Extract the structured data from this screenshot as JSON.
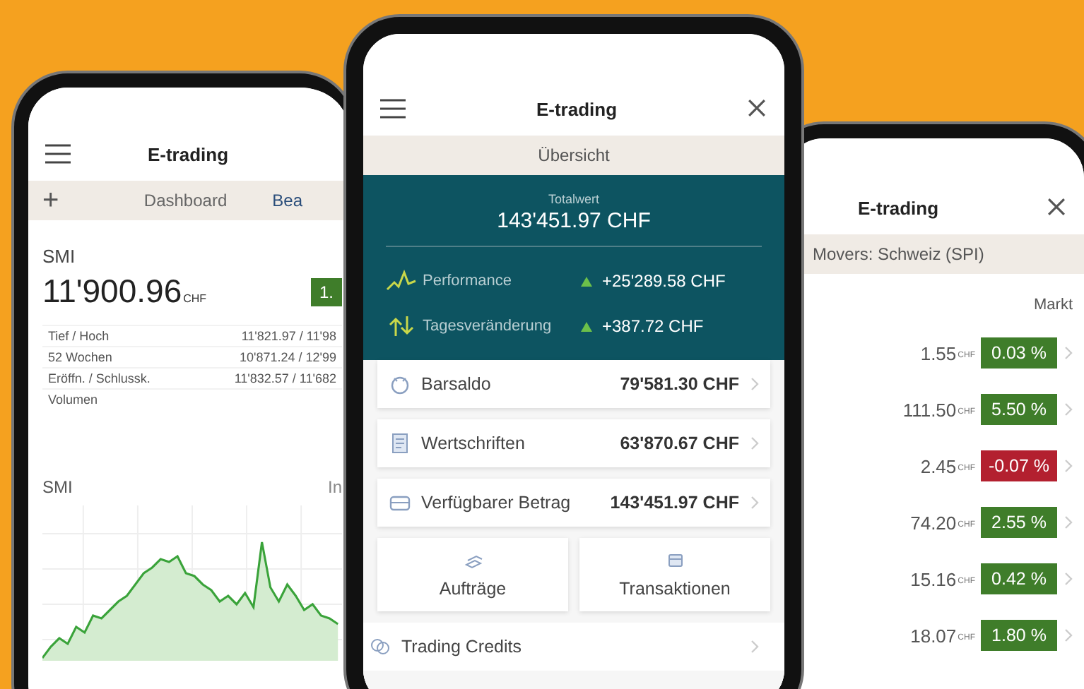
{
  "left_phone": {
    "title": "E-trading",
    "add": "+",
    "tabs": [
      {
        "label": "Dashboard",
        "selected": true
      },
      {
        "label": "Bea",
        "selected": false
      }
    ],
    "index_name": "SMI",
    "value": "11'900.96",
    "currency": "CHF",
    "change": {
      "text": "1.",
      "color": "#3f7d2a"
    },
    "stats": [
      {
        "label": "Tief / Hoch",
        "value": "11'821.97 / 11'98"
      },
      {
        "label": "52 Wochen",
        "value": "10'871.24 / 12'99"
      },
      {
        "label": "Eröffn. / Schlussk.",
        "value": "11'832.57 / 11'682"
      },
      {
        "label": "Volumen"
      }
    ],
    "chart_title": "SMI",
    "chart_tab": "In"
  },
  "center_phone": {
    "title": "E-trading",
    "subtitle": "Übersicht",
    "total_label": "Totalwert",
    "total": "143'451.97 CHF",
    "metrics": [
      {
        "kind": "performance",
        "label": "Performance",
        "value": "+25'289.58 CHF"
      },
      {
        "kind": "daily",
        "label": "Tagesveränderung",
        "value": "+387.72 CHF"
      }
    ],
    "accounts": [
      {
        "kind": "cash",
        "label": "Barsaldo",
        "value": "79'581.30 CHF"
      },
      {
        "kind": "securities",
        "label": "Wertschriften",
        "value": "63'870.67 CHF"
      },
      {
        "kind": "available",
        "label": "Verfügbarer Betrag",
        "value": "143'451.97 CHF"
      }
    ],
    "tiles": [
      {
        "kind": "orders",
        "label": "Aufträge"
      },
      {
        "kind": "transactions",
        "label": "Transaktionen"
      }
    ],
    "credits": "Trading Credits"
  },
  "right_phone": {
    "title": "E-trading",
    "subtitle": "Movers: Schweiz (SPI)",
    "column": "Markt",
    "rows": [
      {
        "price": "1.55",
        "currency": "CHF",
        "change": "0.03 %",
        "color": "#3f7d2a"
      },
      {
        "price": "111.50",
        "currency": "CHF",
        "change": "5.50 %",
        "color": "#3f7d2a"
      },
      {
        "price": "2.45",
        "currency": "CHF",
        "change": "-0.07 %",
        "color": "#b3202f"
      },
      {
        "price": "74.20",
        "currency": "CHF",
        "change": "2.55 %",
        "color": "#3f7d2a"
      },
      {
        "price": "15.16",
        "currency": "CHF",
        "change": "0.42 %",
        "color": "#3f7d2a"
      },
      {
        "price": "18.07",
        "currency": "CHF",
        "change": "1.80 %",
        "color": "#3f7d2a"
      }
    ]
  }
}
